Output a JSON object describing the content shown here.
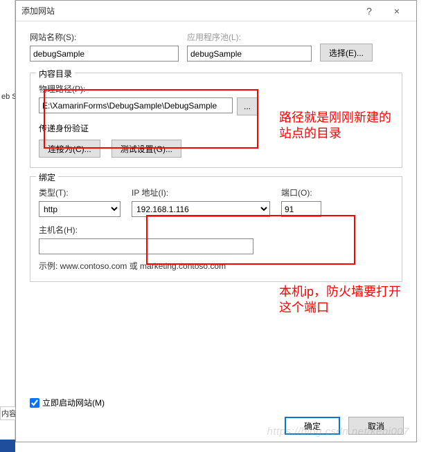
{
  "window": {
    "title": "添加网站",
    "help": "?",
    "close": "×"
  },
  "site": {
    "name_label": "网站名称(S):",
    "name_value": "debugSample",
    "pool_label": "应用程序池(L):",
    "pool_value": "debugSample",
    "select_btn": "选择(E)..."
  },
  "content": {
    "legend": "内容目录",
    "path_label": "物理路径(P):",
    "path_value": "E:\\XamarinForms\\DebugSample\\DebugSample",
    "browse": "...",
    "auth_legend": "传递身份验证",
    "connect_as": "连接为(C)...",
    "test_settings": "测试设置(G)..."
  },
  "binding": {
    "legend": "绑定",
    "type_label": "类型(T):",
    "type_value": "http",
    "ip_label": "IP 地址(I):",
    "ip_value": "192.168.1.116",
    "port_label": "端口(O):",
    "port_value": "91",
    "host_label": "主机名(H):",
    "host_value": "",
    "example": "示例: www.contoso.com 或 marketing.contoso.com"
  },
  "footer": {
    "autostart": "立即启动网站(M)",
    "ok": "确定",
    "cancel": "取消"
  },
  "annotations": {
    "a1_line1": "路径就是刚刚新建的",
    "a1_line2": "站点的目录",
    "a2_line1": "本机ip，防火墙要打开",
    "a2_line2": "这个端口"
  },
  "left": {
    "txt1": "eb S",
    "txt2": "内容"
  },
  "watermark": "https://blog.csdn.net/kebi007"
}
